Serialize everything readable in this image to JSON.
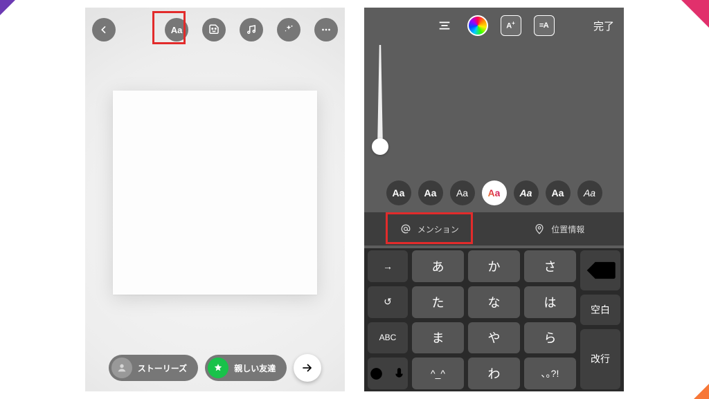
{
  "left": {
    "toolbar": {
      "text_label": "Aa"
    },
    "bottom": {
      "stories": "ストーリーズ",
      "close_friends": "親しい友達"
    }
  },
  "right": {
    "toolbar": {
      "size_label": "A",
      "bg_label": "=A",
      "done": "完了"
    },
    "fonts": {
      "f0": "Aa",
      "f1": "Aa",
      "f2": "Aa",
      "f3": "Aa",
      "f4": "Aa",
      "f5": "Aa",
      "f6": "Aa"
    },
    "suggest": {
      "mention": "メンション",
      "location": "位置情報"
    },
    "keyboard": {
      "tab": "→",
      "undo": "↺",
      "abc": "ABC",
      "r1c1": "あ",
      "r1c2": "か",
      "r1c3": "さ",
      "r2c1": "た",
      "r2c2": "な",
      "r2c3": "は",
      "r3c1": "ま",
      "r3c2": "や",
      "r3c3": "ら",
      "r4c1": "^_^",
      "r4c2": "わ",
      "r4c3": "､｡?!",
      "space": "空白",
      "return": "改行"
    }
  }
}
